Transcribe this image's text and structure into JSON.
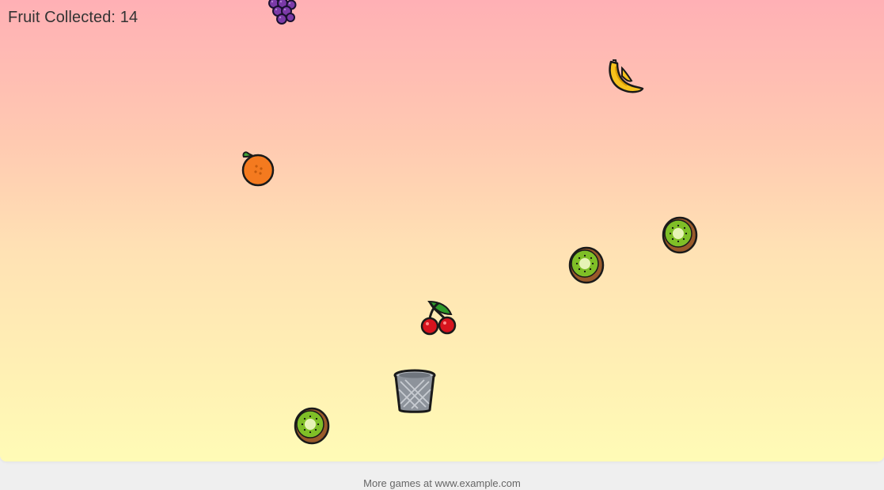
{
  "hud": {
    "score_label": "Fruit Collected: 14",
    "score_value": 14
  },
  "sprites": {
    "grapes": "grapes-icon",
    "banana": "banana-icon",
    "orange": "orange-icon",
    "kiwi": "kiwi-icon",
    "cherries": "cherries-icon",
    "basket": "wastebasket-icon"
  },
  "footer": {
    "text": "More games at www.example.com"
  },
  "colors": {
    "sky_top": "#ffb0b5",
    "sky_bottom": "#fffbb6",
    "page_background": "#efefef"
  }
}
